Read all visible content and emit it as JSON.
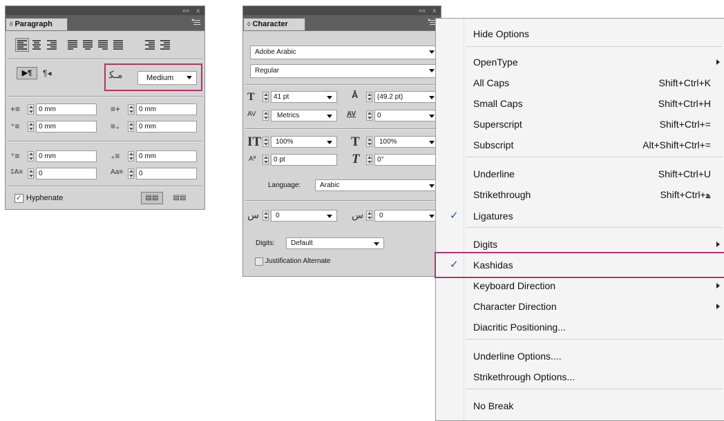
{
  "paragraph": {
    "tab_label": "Paragraph",
    "window_controls": {
      "collapse": "««",
      "close": "x"
    },
    "kashida_value": "Medium",
    "rows": [
      {
        "left_value": "0 mm",
        "right_value": "0 mm"
      },
      {
        "left_value": "0 mm",
        "right_value": "0 mm"
      },
      {
        "left_value": "0 mm",
        "right_value": "0 mm"
      },
      {
        "left_value": "0",
        "right_value": "0"
      }
    ],
    "hyphenate_label": "Hyphenate",
    "hyphenate_checked": true
  },
  "character": {
    "tab_label": "Character",
    "window_controls": {
      "collapse": "««",
      "close": "x"
    },
    "font_family": "Adobe Arabic",
    "font_style": "Regular",
    "font_size": "41 pt",
    "leading": "(49.2 pt)",
    "kerning": "Metrics",
    "tracking": "0",
    "vertical_scale": "100%",
    "horizontal_scale": "100%",
    "baseline_shift": "0 pt",
    "skew": "0°",
    "language_label": "Language:",
    "language_value": "Arabic",
    "diacritic_x": "0",
    "diacritic_y": "0",
    "digits_label": "Digits:",
    "digits_value": "Default",
    "justification_alternate_label": "Justification Alternate",
    "justification_alternate_checked": false
  },
  "menu": {
    "items": [
      {
        "label": "Hide Options",
        "shortcut": "",
        "submenu": false,
        "checked": false
      },
      {
        "label": "OpenType",
        "shortcut": "",
        "submenu": true,
        "checked": false
      },
      {
        "label": "All Caps",
        "shortcut": "Shift+Ctrl+K",
        "submenu": false,
        "checked": false
      },
      {
        "label": "Small Caps",
        "shortcut": "Shift+Ctrl+H",
        "submenu": false,
        "checked": false
      },
      {
        "label": "Superscript",
        "shortcut": "Shift+Ctrl+=",
        "submenu": false,
        "checked": false
      },
      {
        "label": "Subscript",
        "shortcut": "Alt+Shift+Ctrl+=",
        "submenu": false,
        "checked": false
      },
      {
        "label": "Underline",
        "shortcut": "Shift+Ctrl+U",
        "submenu": false,
        "checked": false
      },
      {
        "label": "Strikethrough",
        "shortcut": "Shift+Ctrl+ﻫ",
        "submenu": false,
        "checked": false
      },
      {
        "label": "Ligatures",
        "shortcut": "",
        "submenu": false,
        "checked": true
      },
      {
        "label": "Digits",
        "shortcut": "",
        "submenu": true,
        "checked": false
      },
      {
        "label": "Kashidas",
        "shortcut": "",
        "submenu": false,
        "checked": true
      },
      {
        "label": "Keyboard Direction",
        "shortcut": "",
        "submenu": true,
        "checked": false
      },
      {
        "label": "Character Direction",
        "shortcut": "",
        "submenu": true,
        "checked": false
      },
      {
        "label": "Diacritic Positioning...",
        "shortcut": "",
        "submenu": false,
        "checked": false
      },
      {
        "label": "Underline Options....",
        "shortcut": "",
        "submenu": false,
        "checked": false
      },
      {
        "label": "Strikethrough Options...",
        "shortcut": "",
        "submenu": false,
        "checked": false
      },
      {
        "label": "No Break",
        "shortcut": "",
        "submenu": false,
        "checked": false
      }
    ],
    "check_glyph": "✓"
  },
  "colors": {
    "highlight": "#b3346a",
    "panel_bg": "#d4d4d4",
    "check": "#1d4f9c"
  }
}
